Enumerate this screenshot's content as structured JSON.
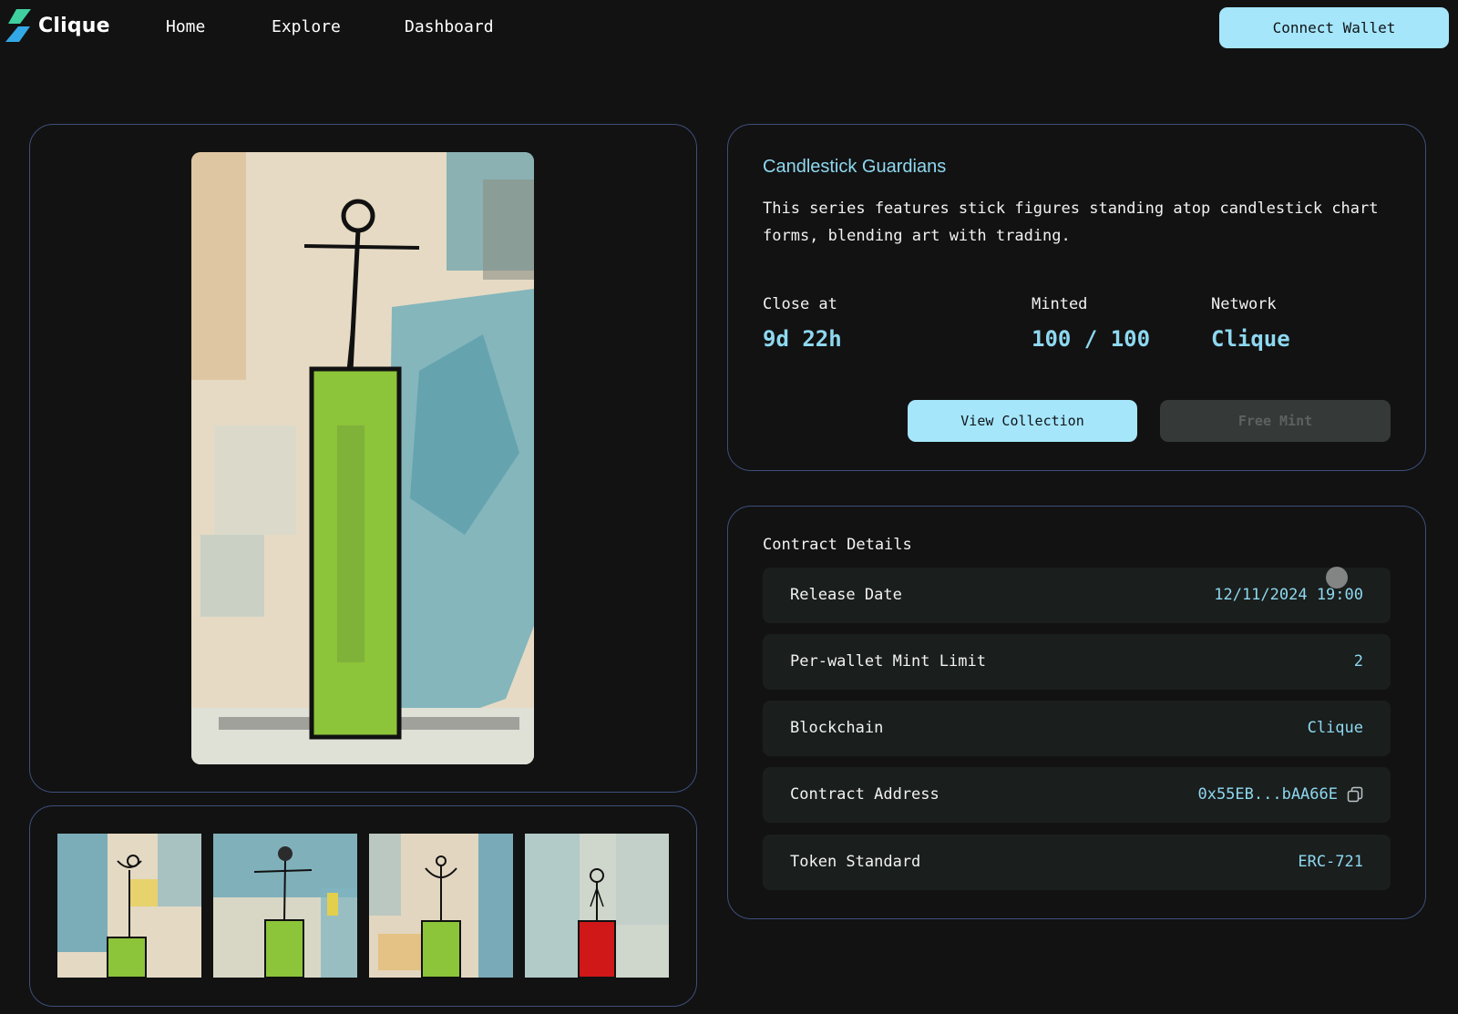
{
  "brand": {
    "name": "Clique"
  },
  "nav": {
    "links": [
      {
        "label": "Home"
      },
      {
        "label": "Explore"
      },
      {
        "label": "Dashboard"
      }
    ],
    "connect_label": "Connect Wallet"
  },
  "collection": {
    "title": "Candlestick Guardians",
    "description": "This series features stick figures standing atop candlestick chart forms, blending art with trading.",
    "stats": [
      {
        "label": "Close at",
        "value": "9d 22h"
      },
      {
        "label": "Minted",
        "value": "100 / 100"
      },
      {
        "label": "Network",
        "value": "Clique"
      }
    ],
    "view_label": "View Collection",
    "mint_label": "Free Mint"
  },
  "contract": {
    "title": "Contract Details",
    "rows": [
      {
        "label": "Release Date",
        "value": "12/11/2024 19:00"
      },
      {
        "label": "Per-wallet Mint Limit",
        "value": "2"
      },
      {
        "label": "Blockchain",
        "value": "Clique"
      },
      {
        "label": "Contract Address",
        "value": "0x55EB...bAA66E"
      },
      {
        "label": "Token Standard",
        "value": "ERC-721"
      }
    ]
  },
  "thumbnails": [
    {
      "candle_color": "#8cc43a"
    },
    {
      "candle_color": "#8cc43a"
    },
    {
      "candle_color": "#8cc43a"
    },
    {
      "candle_color": "#d01818"
    }
  ],
  "colors": {
    "accent": "#a5e6fb",
    "accent_text": "#8ed8f0",
    "panel_border": "#3d4f7c",
    "background": "#121212",
    "row_background": "#1a1e1d",
    "disabled_button": "#353a38"
  },
  "icons": {
    "logo": "lightning-bolt-icon",
    "copy": "copy-icon"
  }
}
